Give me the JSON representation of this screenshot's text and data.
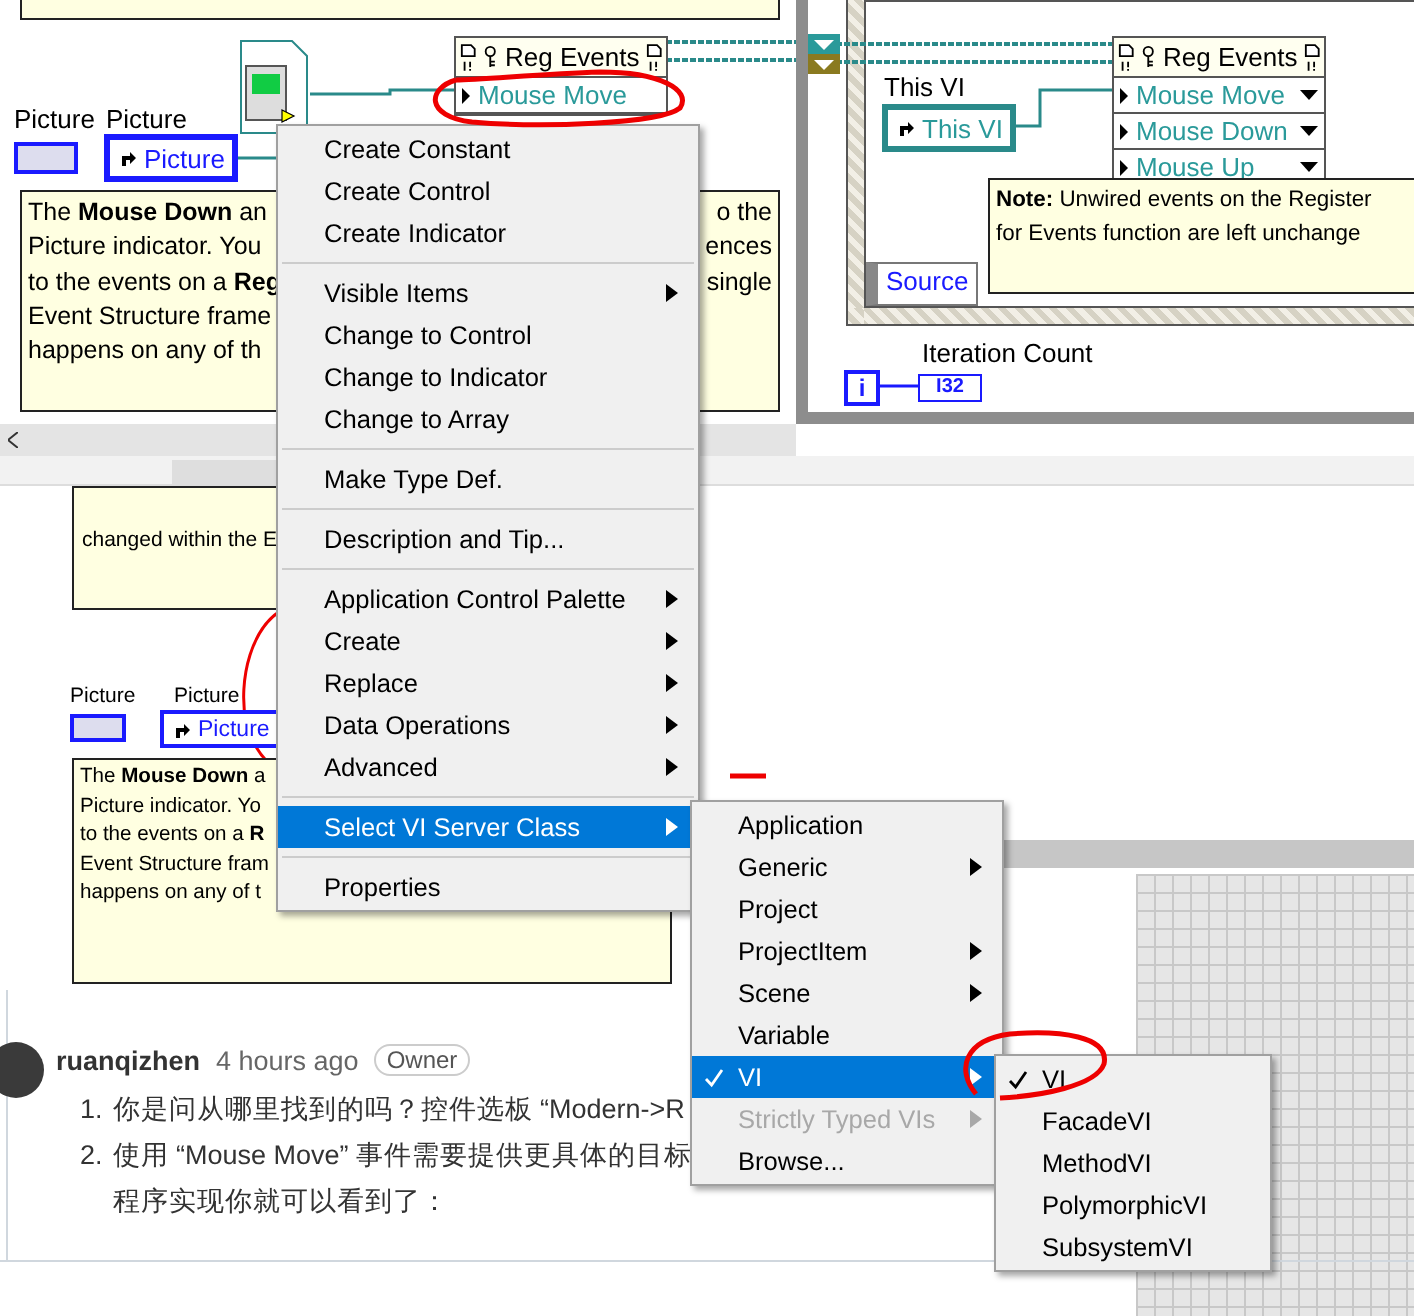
{
  "top_diagram": {
    "picture_indicator_label": "Picture",
    "picture_ref_label": "Picture",
    "picture_ref": "Picture",
    "reg_events": {
      "title": "Reg Events",
      "events": [
        "Mouse Move"
      ]
    },
    "note_lines": [
      {
        "left": "The **Mouse Down** an",
        "right": "o the"
      },
      {
        "left": "Picture indicator. You",
        "right": "ences"
      },
      {
        "left": "to the events on a **Reg**",
        "right": "single"
      },
      {
        "left": "Event Structure frame"
      },
      {
        "left": "happens on any of th"
      }
    ]
  },
  "event_structure": {
    "this_vi_label": "This VI",
    "this_vi_ref": "This VI",
    "reg_events": {
      "title": "Reg Events",
      "events": [
        "Mouse Move",
        "Mouse Down",
        "Mouse Up"
      ]
    },
    "note_lines": [
      "**Note:** Unwired events on the Register",
      "for Events function are left unchange"
    ],
    "source": "Source",
    "iteration_label": "Iteration Count",
    "loop_index": "i",
    "count_type": "I32"
  },
  "embedded_image": {
    "note_top": "changed within the E",
    "picture_indicator_label": "Picture",
    "picture_ref_label": "Picture",
    "picture_ref": "Picture",
    "note_lines": [
      "The **Mouse Down** a",
      "Picture indicator. Yo",
      "to the events on a **R**",
      "Event Structure fram",
      "happens on any of t"
    ]
  },
  "comment": {
    "author": "ruanqizhen",
    "time": "4 hours ago",
    "badge": "Owner",
    "items": [
      {
        "number": "1.",
        "lines": [
          "你是问从哪里找到的吗？控件选板 “Modern->R"
        ]
      },
      {
        "number": "2.",
        "lines": [
          "使用 “Mouse Move” 事件需要提供更具体的目标",
          "程序实现你就可以看到了："
        ]
      }
    ]
  },
  "context_menu": {
    "items": [
      {
        "kind": "item",
        "label": "Create Constant",
        "submenu": false,
        "selected": false
      },
      {
        "kind": "item",
        "label": "Create Control",
        "submenu": false,
        "selected": false
      },
      {
        "kind": "item",
        "label": "Create Indicator",
        "submenu": false,
        "selected": false
      },
      {
        "kind": "separator"
      },
      {
        "kind": "item",
        "label": "Visible Items",
        "submenu": true,
        "selected": false
      },
      {
        "kind": "item",
        "label": "Change to Control",
        "submenu": false,
        "selected": false
      },
      {
        "kind": "item",
        "label": "Change to Indicator",
        "submenu": false,
        "selected": false
      },
      {
        "kind": "item",
        "label": "Change to Array",
        "submenu": false,
        "selected": false
      },
      {
        "kind": "separator"
      },
      {
        "kind": "item",
        "label": "Make Type Def.",
        "submenu": false,
        "selected": false
      },
      {
        "kind": "separator"
      },
      {
        "kind": "item",
        "label": "Description and Tip...",
        "submenu": false,
        "selected": false
      },
      {
        "kind": "separator"
      },
      {
        "kind": "item",
        "label": "Application Control Palette",
        "submenu": true,
        "selected": false
      },
      {
        "kind": "item",
        "label": "Create",
        "submenu": true,
        "selected": false
      },
      {
        "kind": "item",
        "label": "Replace",
        "submenu": true,
        "selected": false
      },
      {
        "kind": "item",
        "label": "Data Operations",
        "submenu": true,
        "selected": false
      },
      {
        "kind": "item",
        "label": "Advanced",
        "submenu": true,
        "selected": false
      },
      {
        "kind": "separator"
      },
      {
        "kind": "item",
        "label": "Select VI Server Class",
        "submenu": true,
        "selected": true
      },
      {
        "kind": "separator"
      },
      {
        "kind": "item",
        "label": "Properties",
        "submenu": false,
        "selected": false
      }
    ]
  },
  "server_class_menu": {
    "items": [
      {
        "kind": "item",
        "label": "Application",
        "submenu": false,
        "selected": false,
        "checked": false,
        "disabled": false
      },
      {
        "kind": "item",
        "label": "Generic",
        "submenu": true,
        "selected": false,
        "checked": false,
        "disabled": false
      },
      {
        "kind": "item",
        "label": "Project",
        "submenu": false,
        "selected": false,
        "checked": false,
        "disabled": false
      },
      {
        "kind": "item",
        "label": "ProjectItem",
        "submenu": true,
        "selected": false,
        "checked": false,
        "disabled": false
      },
      {
        "kind": "item",
        "label": "Scene",
        "submenu": true,
        "selected": false,
        "checked": false,
        "disabled": false
      },
      {
        "kind": "item",
        "label": "Variable",
        "submenu": false,
        "selected": false,
        "checked": false,
        "disabled": false
      },
      {
        "kind": "item",
        "label": "VI",
        "submenu": true,
        "selected": true,
        "checked": true,
        "disabled": false
      },
      {
        "kind": "item",
        "label": "Strictly Typed VIs",
        "submenu": true,
        "selected": false,
        "checked": false,
        "disabled": true
      },
      {
        "kind": "item",
        "label": "Browse...",
        "submenu": false,
        "selected": false,
        "checked": false,
        "disabled": false
      }
    ]
  },
  "vi_menu": {
    "items": [
      {
        "kind": "item",
        "label": "VI",
        "submenu": false,
        "selected": false,
        "checked": true,
        "disabled": false
      },
      {
        "kind": "item",
        "label": "FacadeVI",
        "submenu": false,
        "selected": false,
        "checked": false,
        "disabled": false
      },
      {
        "kind": "item",
        "label": "MethodVI",
        "submenu": false,
        "selected": false,
        "checked": false,
        "disabled": false
      },
      {
        "kind": "item",
        "label": "PolymorphicVI",
        "submenu": false,
        "selected": false,
        "checked": false,
        "disabled": false
      },
      {
        "kind": "item",
        "label": "SubsystemVI",
        "submenu": false,
        "selected": false,
        "checked": false,
        "disabled": false
      }
    ]
  }
}
